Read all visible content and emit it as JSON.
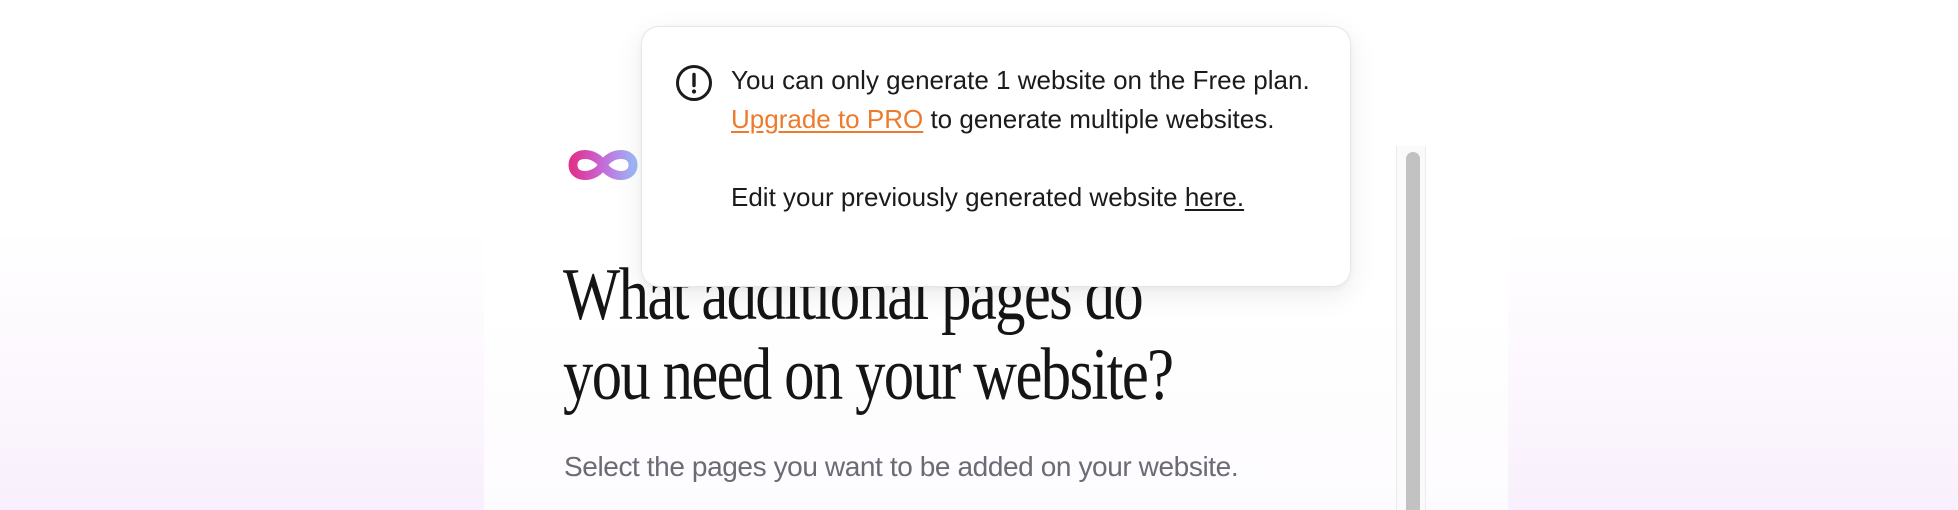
{
  "page": {
    "heading_line1": "What additional pages do",
    "heading_line2": "you need on your website?",
    "subtext": "Select the pages you want to be added on your website."
  },
  "logo": {
    "icon": "infinity-logo-icon",
    "gradient_colors": [
      "#e0338f",
      "#c46ad8",
      "#9fb6f7"
    ]
  },
  "popover": {
    "icon": "alert-circle-icon",
    "message_part1": "You can only generate 1 website on the Free plan.",
    "upgrade_link": "Upgrade to PRO",
    "message_part2": "to generate multiple websites.",
    "edit_text": "Edit your previously generated website",
    "edit_link": "here.",
    "link_color": "#ee7a2b"
  },
  "colors": {
    "heading": "#151515",
    "subtext": "#6b6b75",
    "background_tint": "#f8f0fc",
    "scrollbar_thumb": "#c2c2c2"
  }
}
